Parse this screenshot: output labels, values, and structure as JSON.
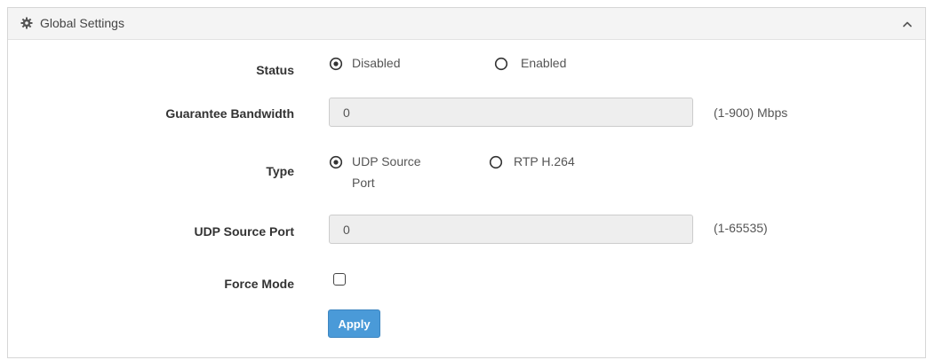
{
  "panel": {
    "title": "Global Settings",
    "icon": "gear-icon",
    "collapse_icon": "chevron-up-icon"
  },
  "status": {
    "label": "Status",
    "selected": "Disabled",
    "options": [
      "Disabled",
      "Enabled"
    ]
  },
  "guarantee_bandwidth": {
    "label": "Guarantee Bandwidth",
    "value": "0",
    "hint": "(1-900) Mbps"
  },
  "type": {
    "label": "Type",
    "selected": "UDP Source Port",
    "options": [
      "UDP Source",
      "Port",
      "RTP H.264"
    ]
  },
  "udp_source_port": {
    "label": "UDP Source Port",
    "value": "0",
    "hint": "(1-65535)"
  },
  "force_mode": {
    "label": "Force Mode",
    "checked": false
  },
  "apply_label": "Apply",
  "colors": {
    "accent": "#4a9ad8",
    "header_bg": "#f4f4f4",
    "input_bg": "#eeeeee"
  }
}
